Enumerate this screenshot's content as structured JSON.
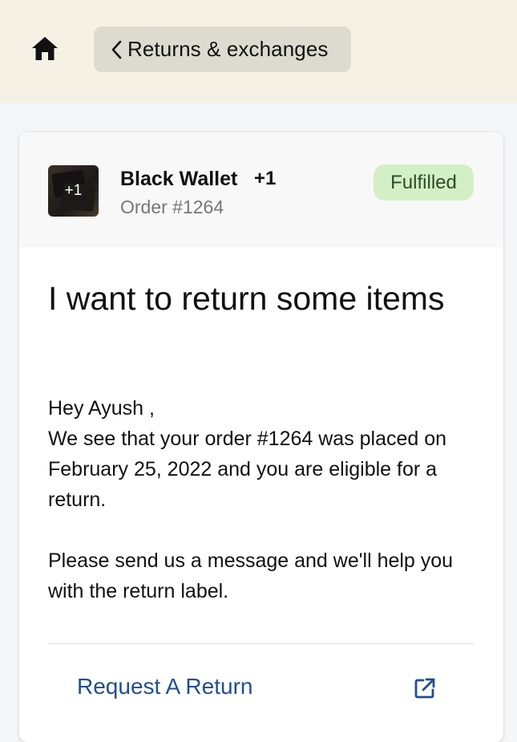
{
  "header": {
    "back_label": "Returns & exchanges"
  },
  "order": {
    "product_name": "Black Wallet",
    "extra_items": "+1",
    "thumb_overlay": "+1",
    "order_number": "Order #1264",
    "status": "Fulfilled"
  },
  "content": {
    "title": "I want to return some items",
    "greeting": "Hey Ayush ,",
    "paragraph_1": "We see that your order #1264 was placed on February 25, 2022 and you are eligible for a return.",
    "paragraph_2": "Please send us a message and we'll help you with the return label."
  },
  "action": {
    "label": "Request A Return"
  },
  "colors": {
    "topbar_bg": "#f5f1e5",
    "back_button_bg": "#dddbd0",
    "status_bg": "#d3f0c4",
    "link": "#1f4f8f"
  },
  "icons": {
    "home": "home-icon",
    "back": "chevron-left-icon",
    "external": "external-link-icon"
  }
}
